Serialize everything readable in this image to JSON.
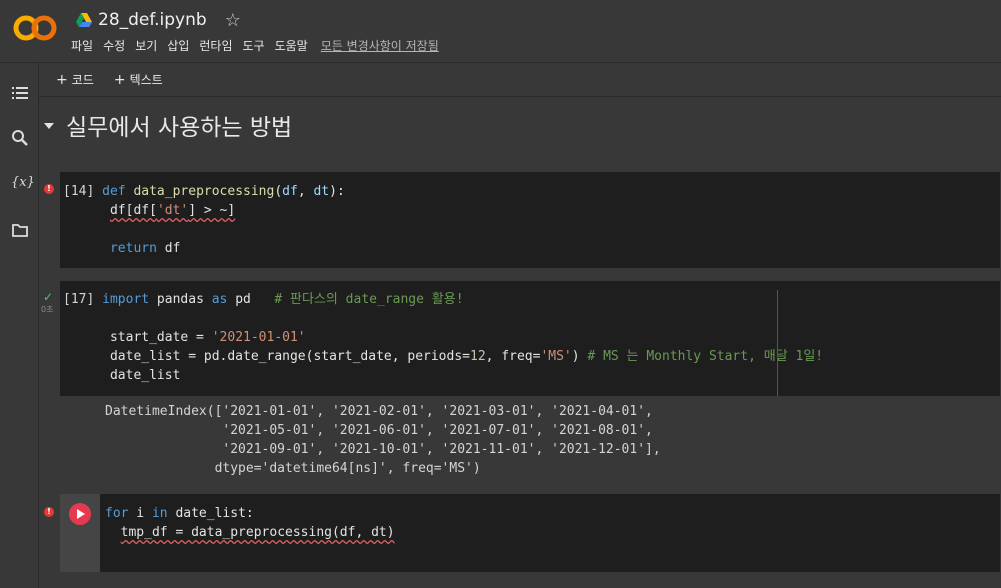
{
  "app": {
    "logo_text": "CO",
    "notebook_title": "28_def.ipynb",
    "menu": [
      "파일",
      "수정",
      "보기",
      "삽입",
      "런타임",
      "도구",
      "도움말"
    ],
    "save_status": "모든 변경사항이 저장됨"
  },
  "toolbar": {
    "add_code": "코드",
    "add_text": "텍스트"
  },
  "section": {
    "title": "실무에서 사용하는 방법"
  },
  "cells": [
    {
      "prompt": "[14]",
      "status": "error",
      "lines": [
        "def data_preprocessing(df, dt):",
        "  df[df['dt'] > ~]",
        "",
        "  return df"
      ]
    },
    {
      "prompt": "[17]",
      "status": "success",
      "exec_time": "0초",
      "lines": [
        "import pandas as pd   # 판다스의 date_range 활용!",
        "",
        "start_date = '2021-01-01'",
        "date_list = pd.date_range(start_date, periods=12, freq='MS') # MS 는 Monthly Start, 매달 1일!",
        "date_list"
      ],
      "output": [
        "DatetimeIndex(['2021-01-01', '2021-02-01', '2021-03-01', '2021-04-01',",
        "               '2021-05-01', '2021-06-01', '2021-07-01', '2021-08-01',",
        "               '2021-09-01', '2021-10-01', '2021-11-01', '2021-12-01'],",
        "              dtype='datetime64[ns]', freq='MS')"
      ]
    },
    {
      "prompt": "",
      "status": "error",
      "lines": [
        "for i in date_list:",
        "  tmp_df = data_preprocessing(df, dt)"
      ]
    }
  ],
  "colors": {
    "background": "#383838",
    "cell_background": "#1e1e1e",
    "keyword": "#569cd6",
    "string": "#ce9178",
    "comment": "#6a9955",
    "error": "#e53935",
    "success": "#5fbf6a"
  },
  "sidebar_icons": [
    "toc-icon",
    "search-icon",
    "variables-icon",
    "folder-icon"
  ]
}
